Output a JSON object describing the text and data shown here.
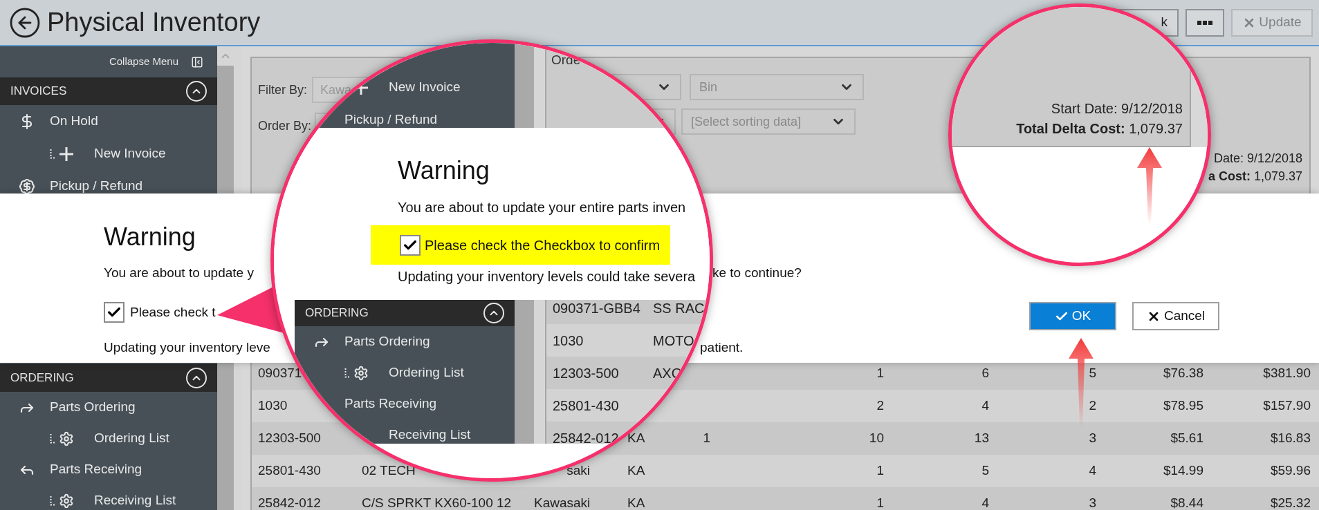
{
  "header": {
    "title": "Physical Inventory",
    "buttons": [
      {
        "kind": "text",
        "label": "k",
        "disabled": false
      },
      {
        "kind": "more",
        "disabled": false
      },
      {
        "kind": "update",
        "label": "Update",
        "disabled": true
      }
    ]
  },
  "sidebar": {
    "collapse_label": "Collapse Menu",
    "top_section": {
      "title": "INVOICES",
      "expanded": true,
      "items": [
        {
          "label": "On Hold",
          "children": [
            {
              "label": "New Invoice"
            }
          ]
        },
        {
          "label": "Pickup / Refund"
        }
      ]
    },
    "bottom_section": {
      "title": "ORDERING",
      "expanded": true,
      "items": [
        {
          "label": "Parts Ordering",
          "children": [
            {
              "label": "Ordering List"
            }
          ]
        },
        {
          "label": "Parts Receiving",
          "children": [
            {
              "label": "Receiving List"
            }
          ]
        }
      ]
    }
  },
  "filter_panel": {
    "filter_label": "Filter By:",
    "filter_value": "Kawa",
    "order_label": "Order By:",
    "sort_dropdowns": [
      {
        "placeholder": "Bin"
      },
      {
        "placeholder": "[Select sorting data]"
      }
    ],
    "start_date": "Date: 9/12/2018",
    "delta_cost": "**a Cost:** 1,079.37"
  },
  "dialog": {
    "title": "Warning",
    "line_1": {
      "left": "You are about to update y",
      "right": "ke to continue?"
    },
    "confirm": {
      "label": "Please check t",
      "checked": true
    },
    "line_2": {
      "left": "Updating your inventory leve",
      "right": "patient."
    },
    "buttons": [
      {
        "kind": "ok",
        "label": "OK",
        "primary": true
      },
      {
        "kind": "cancel",
        "label": "Cancel",
        "primary": false
      }
    ]
  },
  "table": {
    "rows": [
      {
        "column_1": "090371",
        "column_6": "1",
        "column_7": "6",
        "column_8": "5",
        "column_9": "$76.38",
        "column_10": "$381.90"
      },
      {
        "column_1": "1030",
        "column_6": "2",
        "column_7": "4",
        "column_8": "2",
        "column_9": "$78.95",
        "column_10": "$157.90"
      },
      {
        "column_1": "12303-500",
        "column_4": "KA",
        "column_5": "1",
        "column_6": "10",
        "column_7": "13",
        "column_8": "3",
        "column_9": "$5.61",
        "column_10": "$16.83"
      },
      {
        "column_1": "25801-430",
        "column_2": "02 TECH",
        "column_3": "saki",
        "column_4": "KA",
        "column_6": "1",
        "column_7": "5",
        "column_8": "4",
        "column_9": "$14.99",
        "column_10": "$59.96"
      },
      {
        "column_1": "25842-012",
        "column_2": "C/S SPRKT KX60-100 12",
        "column_3": "Kawasaki",
        "column_4": "KA",
        "column_6": "1",
        "column_7": "4",
        "column_8": "3",
        "column_9": "$8.44",
        "column_10": "$25.32"
      }
    ]
  },
  "dialog_callout": {
    "sidebar_items": [
      {
        "label": "New Invoice"
      },
      {
        "label": "Pickup / Refund"
      }
    ],
    "order_label": "Orde",
    "title": "Warning",
    "line_1": "You are about to update your entire parts inven",
    "confirm": {
      "label": "Please check the Checkbox to confirm",
      "checked": true,
      "highlighted": true
    },
    "line_2": "Updating your inventory levels could take severa",
    "section": {
      "title": "ORDERING",
      "expanded": true,
      "items": [
        {
          "label": "Parts Ordering",
          "children": [
            {
              "label": "Ordering List"
            }
          ]
        },
        {
          "label": "Parts Receiving",
          "children": [
            {
              "label": "Receiving List"
            }
          ]
        }
      ]
    },
    "table_rows": [
      {
        "column_1": "090371-GBB4",
        "column_2": "SS RAC"
      },
      {
        "column_1": "1030",
        "column_2": "MOTO"
      },
      {
        "column_1": "12303-500",
        "column_2": "AXO"
      },
      {
        "column_1": "25801-430"
      },
      {
        "column_1": "25842-012"
      }
    ]
  },
  "totals_callout": {
    "start_date": "Start Date: 9/12/2018",
    "delta_cost": "**Total Delta Cost:** 1,079.37"
  }
}
